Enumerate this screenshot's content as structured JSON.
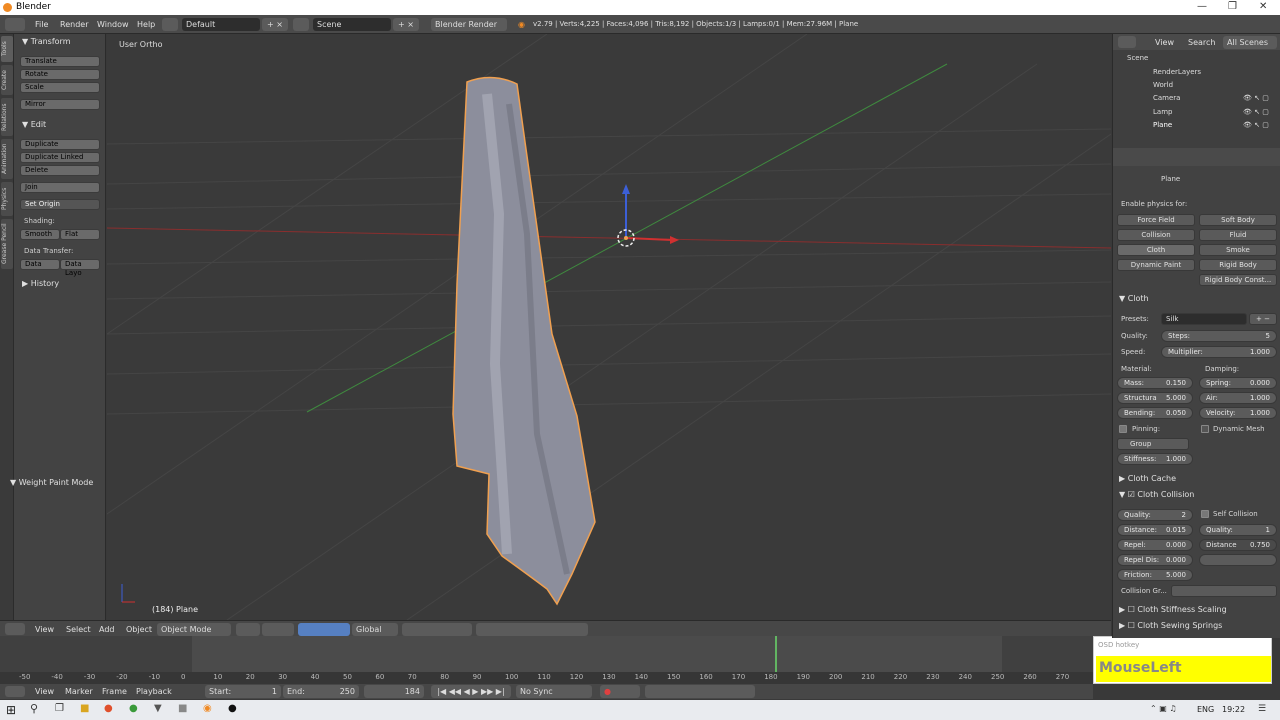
{
  "window": {
    "title": "Blender"
  },
  "menubar": {
    "items": [
      "File",
      "Render",
      "Window",
      "Help"
    ],
    "layout": "Default",
    "scene": "Scene",
    "engine": "Blender Render",
    "stats": "v2.79 | Verts:4,225 | Faces:4,096 | Tris:8,192 | Objects:1/3 | Lamps:0/1 | Mem:27.96M | Plane"
  },
  "tool_tabs": [
    "Tools",
    "Create",
    "Relations",
    "Animation",
    "Physics",
    "Grease Pencil"
  ],
  "toolshelf": {
    "transform_header": "Transform",
    "transform": [
      "Translate",
      "Rotate",
      "Scale"
    ],
    "mirror": "Mirror",
    "edit_header": "Edit",
    "edit": [
      "Duplicate",
      "Duplicate Linked",
      "Delete"
    ],
    "join": "Join",
    "set_origin": "Set Origin",
    "shading_label": "Shading:",
    "smooth": "Smooth",
    "flat": "Flat",
    "data_transfer_label": "Data Transfer:",
    "data": "Data",
    "data_layout": "Data Layo",
    "history": "History",
    "weight_paint": "Weight Paint Mode"
  },
  "viewport": {
    "view_label": "User Ortho",
    "object_label": "(184) Plane"
  },
  "viewport_header": {
    "view": "View",
    "select": "Select",
    "add": "Add",
    "object": "Object",
    "mode": "Object Mode",
    "orientation": "Global"
  },
  "timeline": {
    "ticks": [
      "-50",
      "-40",
      "-30",
      "-20",
      "-10",
      "0",
      "10",
      "20",
      "30",
      "40",
      "50",
      "60",
      "70",
      "80",
      "90",
      "100",
      "110",
      "120",
      "130",
      "140",
      "150",
      "160",
      "170",
      "180",
      "190",
      "200",
      "210",
      "220",
      "230",
      "240",
      "250",
      "260",
      "270"
    ],
    "current_frame_fraction": 0.72,
    "menus": [
      "View",
      "Marker",
      "Frame",
      "Playback"
    ],
    "start_label": "Start:",
    "start": "1",
    "end_label": "End:",
    "end": "250",
    "current": "184",
    "sync": "No Sync"
  },
  "outliner": {
    "view": "View",
    "search": "Search",
    "filter": "All Scenes",
    "rows": [
      "Scene",
      "RenderLayers",
      "World",
      "Camera",
      "Lamp",
      "Plane"
    ]
  },
  "properties": {
    "object_name": "Plane",
    "enable_label": "Enable physics for:",
    "physics_buttons": [
      "Force Field",
      "Soft Body",
      "Collision",
      "Fluid",
      "Cloth",
      "Smoke",
      "Dynamic Paint",
      "Rigid Body",
      "Rigid Body Const..."
    ],
    "cloth_header": "Cloth",
    "presets_label": "Presets:",
    "preset": "Silk",
    "quality_label": "Quality:",
    "steps_label": "Steps:",
    "steps": "5",
    "speed_label": "Speed:",
    "multiplier_label": "Multiplier:",
    "multiplier": "1.000",
    "material_label": "Material:",
    "damping_label": "Damping:",
    "mass_label": "Mass:",
    "mass": "0.150",
    "structural_label": "Structura",
    "structural": "5.000",
    "bending_label": "Bending:",
    "bending": "0.050",
    "spring_label": "Spring:",
    "spring": "0.000",
    "air_label": "Air:",
    "air": "1.000",
    "velocity_label": "Velocity:",
    "velocity": "1.000",
    "pinning_label": "Pinning:",
    "dynamic_mesh_label": "Dynamic Mesh",
    "group_label": "Group",
    "stiffness_label": "Stiffness:",
    "stiffness": "1.000",
    "cloth_cache": "Cloth Cache",
    "cloth_collision": "Cloth Collision",
    "cc_quality_label": "Quality:",
    "cc_quality": "2",
    "self_collision_label": "Self Collision",
    "distance_label": "Distance:",
    "distance": "0.015",
    "sc_quality_label": "Quality:",
    "sc_quality": "1",
    "repel_label": "Repel:",
    "repel": "0.000",
    "sc_distance_label": "Distance",
    "sc_distance": "0.750",
    "repel_dist_label": "Repel Dis:",
    "repel_dist": "0.000",
    "friction_label": "Friction:",
    "friction": "5.000",
    "collision_group_label": "Collision Gr...",
    "stiffness_scaling": "Cloth Stiffness Scaling",
    "sewing_springs": "Cloth Sewing Springs"
  },
  "osd": {
    "label": "OSD hotkey",
    "key": "MouseLeft"
  },
  "taskbar": {
    "lang": "ENG",
    "time": "19:22"
  },
  "colors": {
    "accent": "#5680c2",
    "selection_outline": "#f0a050",
    "osd_key_bg": "#ffff00"
  }
}
